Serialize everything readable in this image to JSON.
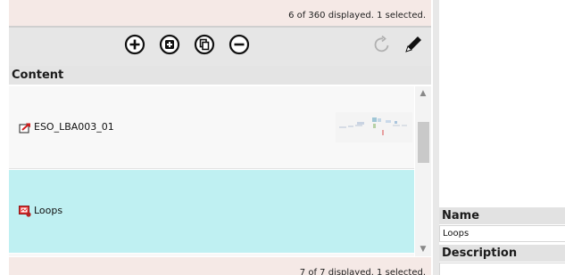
{
  "top_status": {
    "text": "6 of 360 displayed. 1 selected."
  },
  "toolbar": {
    "buttons": [
      {
        "icon": "plus-circle-icon"
      },
      {
        "icon": "add-copy-icon"
      },
      {
        "icon": "copy-icon"
      },
      {
        "icon": "minus-circle-icon"
      },
      {
        "icon": "refresh-icon"
      },
      {
        "icon": "pencil-icon"
      }
    ]
  },
  "content": {
    "header": "Content",
    "items": [
      {
        "label": "ESO_LBA003_01",
        "icon": "export-arrow-icon",
        "selected": false
      },
      {
        "label": "Loops",
        "icon": "loop-image-icon",
        "selected": true
      }
    ],
    "status": "7 of 7 displayed. 1 selected."
  },
  "colors": {
    "selected_row": "#bff0f2",
    "status_bar": "#f5e9e6",
    "toolbar": "#e6e6e6"
  },
  "properties": {
    "name_label": "Name",
    "name_value": "Loops",
    "description_label": "Description"
  }
}
